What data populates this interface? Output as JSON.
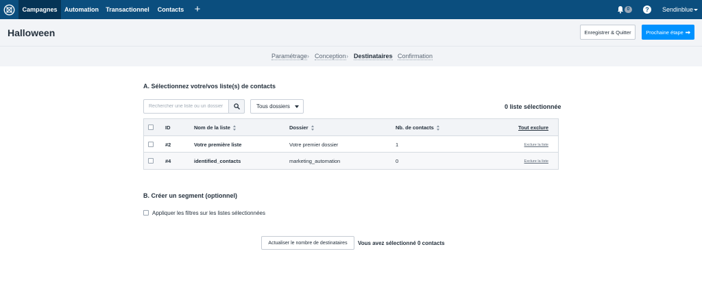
{
  "nav": {
    "logo_icon": "sendinblue-logo-icon",
    "items": [
      {
        "label": "Campagnes",
        "active": true
      },
      {
        "label": "Automation",
        "active": false
      },
      {
        "label": "Transactionnel",
        "active": false
      },
      {
        "label": "Contacts",
        "active": false
      }
    ],
    "plus_label": "+",
    "notification_count": "0",
    "help_label": "?",
    "account_label": "Sendinblue"
  },
  "header": {
    "title": "Halloween",
    "save_label": "Enregistrer & Quitter",
    "next_label": "Prochaine étape"
  },
  "breadcrumb": [
    {
      "label": "Paramétrage",
      "current": false
    },
    {
      "label": "Conception",
      "current": false
    },
    {
      "label": "Destinataires",
      "current": true
    },
    {
      "label": "Confirmation",
      "current": false
    }
  ],
  "section_a": {
    "title": "A. Sélectionnez votre/vos liste(s) de contacts",
    "search_placeholder": "Rechercher une liste ou un dossier",
    "folder_select_value": "Tous dossiers",
    "selected_count": "0 liste sélectionnée",
    "columns": {
      "id": "ID",
      "name": "Nom de la liste",
      "folder": "Dossier",
      "contacts": "Nb. de contacts",
      "exclude_all": "Tout exclure"
    },
    "rows": [
      {
        "id": "#2",
        "name": "Votre première liste",
        "folder": "Votre premier dossier",
        "contacts": "1",
        "action": "Exclure la liste"
      },
      {
        "id": "#4",
        "name": "identified_contacts",
        "folder": "marketing_automation",
        "contacts": "0",
        "action": "Exclure la liste"
      }
    ]
  },
  "section_b": {
    "title": "B. Créer un segment (optionnel)",
    "filter_label": "Appliquer les filtres sur les listes sélectionnées"
  },
  "footer": {
    "refresh_label": "Actualiser le nombre de destinataires",
    "summary": "Vous avez sélectionné 0 contacts"
  },
  "colors": {
    "nav_bg": "#0b4e7e",
    "nav_active_bg": "#053456",
    "primary_button": "#0092ff",
    "band_bg": "#f2f4f7"
  }
}
